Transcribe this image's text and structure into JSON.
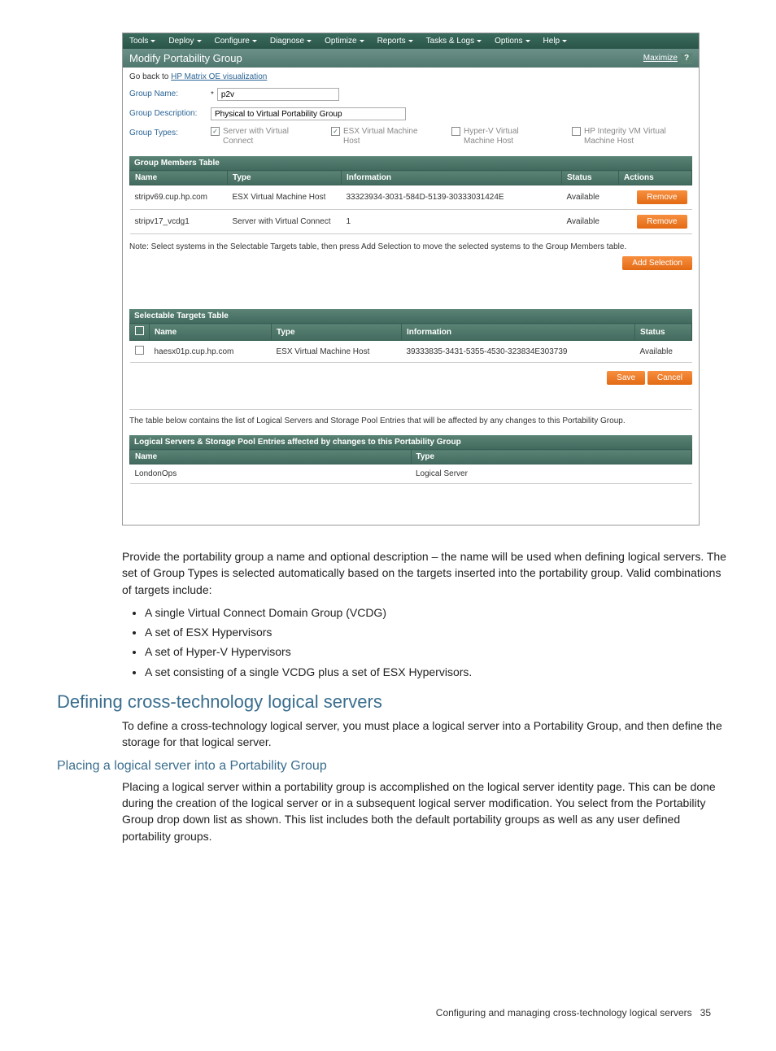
{
  "screenshot": {
    "menu": [
      "Tools",
      "Deploy",
      "Configure",
      "Diagnose",
      "Optimize",
      "Reports",
      "Tasks & Logs",
      "Options",
      "Help"
    ],
    "title": "Modify Portability Group",
    "maximize": "Maximize",
    "back": {
      "prefix": "Go back to ",
      "link": "HP Matrix OE visualization"
    },
    "form": {
      "name_label": "Group Name:",
      "name_value": "p2v",
      "desc_label": "Group Description:",
      "desc_value": "Physical to Virtual Portability Group",
      "types_label": "Group Types:",
      "types": [
        {
          "label": "Server with Virtual Connect",
          "checked": true
        },
        {
          "label": "ESX Virtual Machine Host",
          "checked": true
        },
        {
          "label": "Hyper-V Virtual Machine Host",
          "checked": false
        },
        {
          "label": "HP Integrity VM Virtual Machine Host",
          "checked": false
        }
      ]
    },
    "members": {
      "header": "Group Members Table",
      "cols": [
        "Name",
        "Type",
        "Information",
        "Status",
        "Actions"
      ],
      "rows": [
        {
          "name": "stripv69.cup.hp.com",
          "type": "ESX Virtual Machine Host",
          "info": "33323934-3031-584D-5139-30333031424E",
          "status": "Available",
          "action": "Remove"
        },
        {
          "name": "stripv17_vcdg1",
          "type": "Server with Virtual Connect",
          "info": "1",
          "status": "Available",
          "action": "Remove"
        }
      ]
    },
    "note": "Note: Select systems in the Selectable Targets table, then press Add Selection to move the selected systems to the Group Members table.",
    "add_selection": "Add Selection",
    "selectable": {
      "header": "Selectable Targets Table",
      "cols": [
        "Name",
        "Type",
        "Information",
        "Status"
      ],
      "rows": [
        {
          "name": "haesx01p.cup.hp.com",
          "type": "ESX Virtual Machine Host",
          "info": "39333835-3431-5355-4530-323834E303739",
          "status": "Available"
        }
      ]
    },
    "save": "Save",
    "cancel": "Cancel",
    "logical_note": "The table below contains the list of Logical Servers and Storage Pool Entries that will be affected by any changes to this Portability Group.",
    "logical": {
      "header": "Logical Servers & Storage Pool Entries affected by changes to this Portability Group",
      "cols": [
        "Name",
        "Type"
      ],
      "rows": [
        {
          "name": "LondonOps",
          "type": "Logical Server"
        }
      ]
    }
  },
  "doc": {
    "intro": "Provide the portability group a name and optional description – the name will be used when defining logical servers. The set of Group Types is selected automatically based on the targets inserted into the portability group. Valid combinations of targets include:",
    "bullets": [
      "A single Virtual Connect Domain Group (VCDG)",
      "A set of ESX Hypervisors",
      "A set of Hyper-V Hypervisors",
      "A set consisting of a single VCDG plus a set of ESX Hypervisors."
    ],
    "h2": "Defining cross-technology logical servers",
    "p2": "To define a cross-technology logical server, you must place a logical server into a Portability Group, and then define the storage for that logical server.",
    "h3": "Placing a logical server into a Portability Group",
    "p3": "Placing a logical server within a portability group is accomplished on the logical server identity page. This can be done during the creation of the logical server or in a subsequent logical server modification. You select from the Portability Group drop down list as shown. This list includes both the default portability groups as well as any user defined portability groups.",
    "footer": "Configuring and managing cross-technology logical servers",
    "page": "35"
  }
}
